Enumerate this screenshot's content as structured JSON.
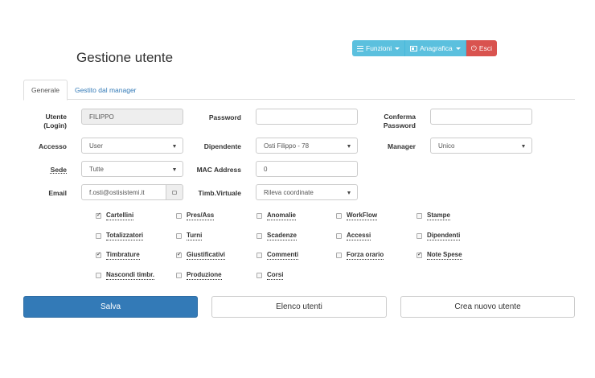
{
  "topbar": {
    "funzioni_label": "Funzioni",
    "anagrafica_label": "Anagrafica",
    "esci_label": "Esci"
  },
  "page_title": "Gestione utente",
  "tabs": [
    {
      "label": "Generale"
    },
    {
      "label": "Gestito dal manager"
    }
  ],
  "form": {
    "utente_label_1": "Utente",
    "utente_label_2": "(Login)",
    "utente_value": "FILIPPO",
    "password_label": "Password",
    "password_value": "",
    "conferma_label_1": "Conferma",
    "conferma_label_2": "Password",
    "conferma_value": "",
    "accesso_label": "Accesso",
    "accesso_value": "User",
    "dipendente_label": "Dipendente",
    "dipendente_value": "Osti Filippo - 78",
    "manager_label": "Manager",
    "manager_value": "Unico",
    "sede_label": "Sede",
    "sede_value": "Tutte",
    "mac_label": "MAC Address",
    "mac_value": "0",
    "email_label": "Email",
    "email_value": "f.osti@ostisistemi.it",
    "timb_label": "Timb.Virtuale",
    "timb_value": "Rileva coordinate"
  },
  "checkboxes": [
    {
      "label": "Cartellini",
      "checked": true
    },
    {
      "label": "Pres/Ass",
      "checked": false
    },
    {
      "label": "Anomalie",
      "checked": false
    },
    {
      "label": "WorkFlow",
      "checked": false
    },
    {
      "label": "Stampe",
      "checked": false
    },
    {
      "label": "Totalizzatori",
      "checked": false
    },
    {
      "label": "Turni",
      "checked": false
    },
    {
      "label": "Scadenze",
      "checked": false
    },
    {
      "label": "Accessi",
      "checked": false
    },
    {
      "label": "Dipendenti",
      "checked": false
    },
    {
      "label": "Timbrature",
      "checked": true
    },
    {
      "label": "Giustificativi",
      "checked": true
    },
    {
      "label": "Commenti",
      "checked": false
    },
    {
      "label": "Forza orario",
      "checked": false
    },
    {
      "label": "Note Spese",
      "checked": true
    },
    {
      "label": "Nascondi timbr.",
      "checked": false
    },
    {
      "label": "Produzione",
      "checked": false
    },
    {
      "label": "Corsi",
      "checked": false
    }
  ],
  "buttons": {
    "salva": "Salva",
    "elenco": "Elenco utenti",
    "crea": "Crea nuovo utente"
  }
}
